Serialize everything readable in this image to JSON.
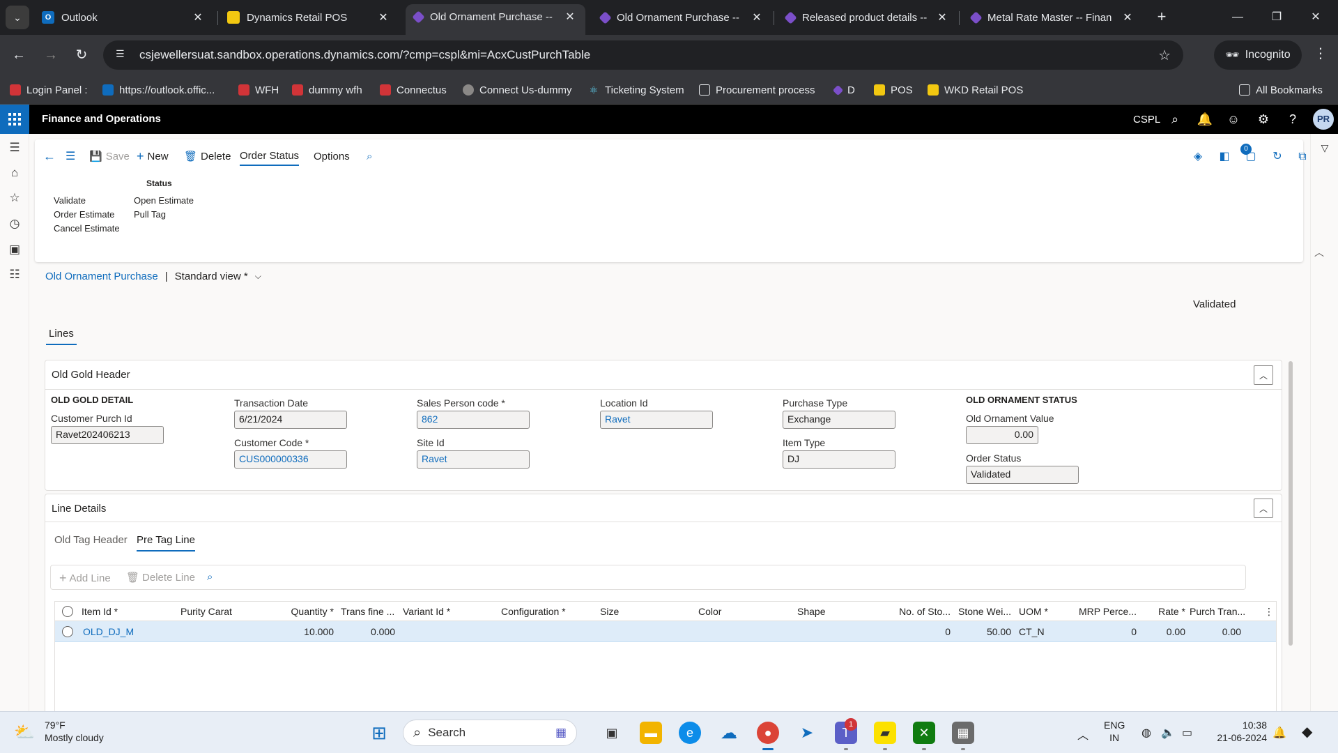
{
  "browser": {
    "tabs": [
      {
        "title": "Outlook",
        "favicon_color": "#0f6cbd",
        "favicon_char": "O"
      },
      {
        "title": "Dynamics Retail POS",
        "favicon_color": "#f2c811",
        "favicon_char": ""
      },
      {
        "title": "Old Ornament Purchase --",
        "favicon_color": "#7b4fc9",
        "favicon_char": "",
        "active": true
      },
      {
        "title": "Old Ornament Purchase --",
        "favicon_color": "#7b4fc9",
        "favicon_char": ""
      },
      {
        "title": "Released product details --",
        "favicon_color": "#7b4fc9",
        "favicon_char": ""
      },
      {
        "title": "Metal Rate Master -- Finan",
        "favicon_color": "#7b4fc9",
        "favicon_char": ""
      }
    ],
    "url": "csjewellersuat.sandbox.operations.dynamics.com/?cmp=cspl&mi=AcxCustPurchTable",
    "incognito_label": "Incognito",
    "bookmarks": [
      {
        "label": "Login Panel :",
        "color": "#d13438"
      },
      {
        "label": "https://outlook.offic...",
        "color": "#0f6cbd"
      },
      {
        "label": "WFH",
        "color": "#d13438"
      },
      {
        "label": "dummy wfh",
        "color": "#d13438"
      },
      {
        "label": "Connectus",
        "color": "#d13438"
      },
      {
        "label": "Connect Us-dummy",
        "color": "#8a8886"
      },
      {
        "label": "Ticketing System",
        "color": "#61dafb"
      },
      {
        "label": "Procurement process",
        "color": "#e8eaed"
      },
      {
        "label": "D",
        "color": "#7b4fc9"
      },
      {
        "label": "POS",
        "color": "#f2c811"
      },
      {
        "label": "WKD Retail POS",
        "color": "#f2c811"
      }
    ],
    "all_bookmarks": "All Bookmarks"
  },
  "navbar": {
    "app_name": "Finance and Operations",
    "company": "CSPL",
    "avatar_initials": "PR"
  },
  "actionpane": {
    "save": "Save",
    "new": "New",
    "delete": "Delete",
    "order_status_tab": "Order Status",
    "options_tab": "Options",
    "notification_count": "0",
    "group_title": "Status",
    "items_col1": [
      "Validate",
      "Order Estimate",
      "Cancel Estimate"
    ],
    "items_col2": [
      "Open Estimate",
      "Pull Tag"
    ]
  },
  "page": {
    "breadcrumb_link": "Old Ornament Purchase",
    "breadcrumb_sep": "|",
    "view_name": "Standard view *",
    "status": "Validated",
    "lines_tab": "Lines"
  },
  "header_panel": {
    "title": "Old Gold Header",
    "section_detail": "OLD GOLD DETAIL",
    "section_status": "OLD ORNAMENT STATUS",
    "customer_purch_id_label": "Customer Purch Id",
    "customer_purch_id": "Ravet202406213",
    "transaction_date_label": "Transaction Date",
    "transaction_date": "6/21/2024",
    "customer_code_label": "Customer Code *",
    "customer_code": "CUS000000336",
    "sales_person_label": "Sales Person code *",
    "sales_person": "862",
    "site_id_label": "Site Id",
    "site_id": "Ravet",
    "location_id_label": "Location Id",
    "location_id": "Ravet",
    "purchase_type_label": "Purchase Type",
    "purchase_type": "Exchange",
    "item_type_label": "Item Type",
    "item_type": "DJ",
    "old_ornament_value_label": "Old Ornament Value",
    "old_ornament_value": "0.00",
    "order_status_label": "Order Status",
    "order_status": "Validated"
  },
  "line_panel": {
    "title": "Line Details",
    "subtabs": [
      "Old Tag Header",
      "Pre Tag Line"
    ],
    "add_line": "Add Line",
    "delete_line": "Delete Line",
    "columns": [
      "Item Id *",
      "Purity Carat",
      "Quantity *",
      "Trans fine ...",
      "Variant Id *",
      "Configuration *",
      "Size",
      "Color",
      "Shape",
      "No. of Sto...",
      "Stone Wei...",
      "UOM *",
      "MRP Perce...",
      "Rate *",
      "Purch Tran..."
    ],
    "rows": [
      {
        "item_id": "OLD_DJ_M",
        "purity": "",
        "quantity": "10.000",
        "trans_fine": "0.000",
        "variant": "",
        "configuration": "",
        "size": "",
        "color": "",
        "shape": "",
        "no_stones": "0",
        "stone_weight": "50.00",
        "uom": "CT_N",
        "mrp_percent": "0",
        "rate": "0.00",
        "purch_trans": "0.00"
      }
    ]
  },
  "taskbar": {
    "temp": "79°F",
    "weather": "Mostly cloudy",
    "search": "Search",
    "teams_badge": "1",
    "lang1": "ENG",
    "lang2": "IN",
    "time": "10:38",
    "date": "21-06-2024"
  },
  "colors": {
    "accent": "#0f6cbd",
    "selected_row": "#deecf9"
  }
}
